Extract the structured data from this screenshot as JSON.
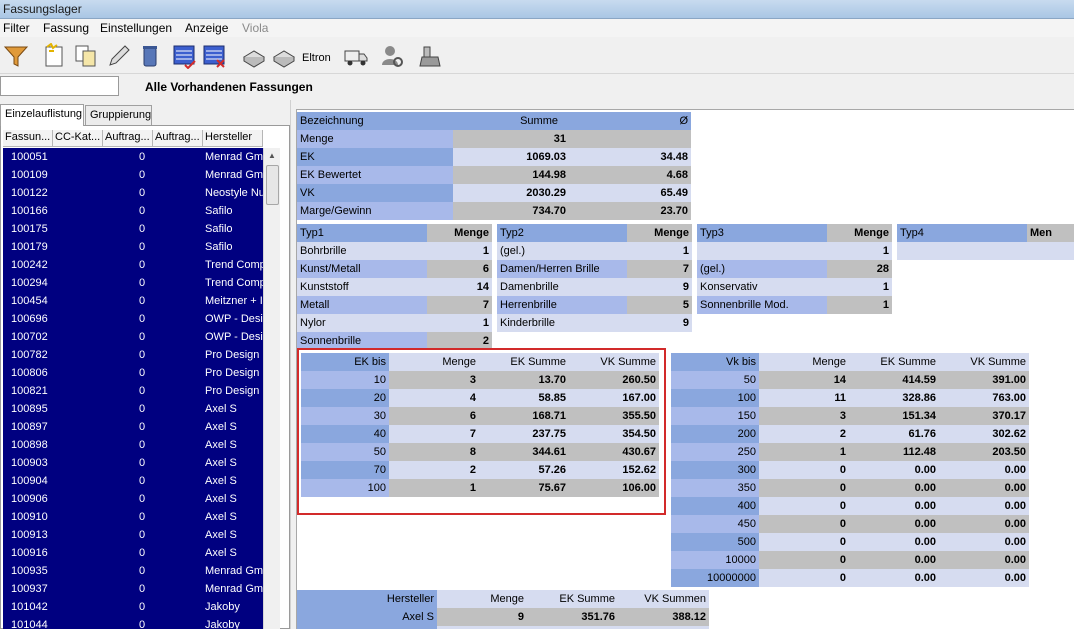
{
  "window": {
    "title": "Fassungslager"
  },
  "menu": [
    {
      "label": "Filter",
      "enabled": true
    },
    {
      "label": "Fassung",
      "enabled": true
    },
    {
      "label": "Einstellungen",
      "enabled": true
    },
    {
      "label": "Anzeige",
      "enabled": true
    },
    {
      "label": "Viola",
      "enabled": false
    }
  ],
  "toolbar": {
    "eltron_label": "Eltron"
  },
  "search": {
    "value": "",
    "placeholder": ""
  },
  "page_heading": "Alle Vorhandenen Fassungen",
  "tabs": [
    {
      "label": "Einzelauflistung",
      "active": true
    },
    {
      "label": "Gruppierung",
      "active": false
    }
  ],
  "grid": {
    "columns": [
      "Fassun...",
      "CC-Kat...",
      "Auftrag...",
      "Auftrag...",
      "Hersteller"
    ],
    "rows": [
      {
        "id": "100051",
        "cc": "0",
        "hersteller": "Menrad Gmb"
      },
      {
        "id": "100109",
        "cc": "0",
        "hersteller": "Menrad Gmb"
      },
      {
        "id": "100122",
        "cc": "0",
        "hersteller": "Neostyle Nu"
      },
      {
        "id": "100166",
        "cc": "0",
        "hersteller": "Safilo"
      },
      {
        "id": "100175",
        "cc": "0",
        "hersteller": "Safilo"
      },
      {
        "id": "100179",
        "cc": "0",
        "hersteller": "Safilo"
      },
      {
        "id": "100242",
        "cc": "0",
        "hersteller": "Trend Comp"
      },
      {
        "id": "100294",
        "cc": "0",
        "hersteller": "Trend Comp"
      },
      {
        "id": "100454",
        "cc": "0",
        "hersteller": "Meitzner + I"
      },
      {
        "id": "100696",
        "cc": "0",
        "hersteller": "OWP - Desig"
      },
      {
        "id": "100702",
        "cc": "0",
        "hersteller": "OWP - Desig"
      },
      {
        "id": "100782",
        "cc": "0",
        "hersteller": "Pro Design"
      },
      {
        "id": "100806",
        "cc": "0",
        "hersteller": "Pro Design"
      },
      {
        "id": "100821",
        "cc": "0",
        "hersteller": "Pro Design"
      },
      {
        "id": "100895",
        "cc": "0",
        "hersteller": "Axel S"
      },
      {
        "id": "100897",
        "cc": "0",
        "hersteller": "Axel S"
      },
      {
        "id": "100898",
        "cc": "0",
        "hersteller": "Axel S"
      },
      {
        "id": "100903",
        "cc": "0",
        "hersteller": "Axel S"
      },
      {
        "id": "100904",
        "cc": "0",
        "hersteller": "Axel S"
      },
      {
        "id": "100906",
        "cc": "0",
        "hersteller": "Axel S"
      },
      {
        "id": "100910",
        "cc": "0",
        "hersteller": "Axel S"
      },
      {
        "id": "100913",
        "cc": "0",
        "hersteller": "Axel S"
      },
      {
        "id": "100916",
        "cc": "0",
        "hersteller": "Axel S"
      },
      {
        "id": "100935",
        "cc": "0",
        "hersteller": "Menrad Gmb"
      },
      {
        "id": "100937",
        "cc": "0",
        "hersteller": "Menrad Gmb"
      },
      {
        "id": "101042",
        "cc": "0",
        "hersteller": "Jakoby"
      },
      {
        "id": "101044",
        "cc": "0",
        "hersteller": "Jakoby"
      }
    ]
  },
  "summary": {
    "headers": [
      "Bezeichnung",
      "Summe",
      "Ø"
    ],
    "rows": [
      {
        "label": "Menge",
        "sum": "31",
        "avg": ""
      },
      {
        "label": "EK",
        "sum": "1069.03",
        "avg": "34.48"
      },
      {
        "label": "EK Bewertet",
        "sum": "144.98",
        "avg": "4.68"
      },
      {
        "label": "VK",
        "sum": "2030.29",
        "avg": "65.49"
      },
      {
        "label": "Marge/Gewinn",
        "sum": "734.70",
        "avg": "23.70"
      }
    ]
  },
  "typ1": {
    "headers": [
      "Typ1",
      "Menge"
    ],
    "rows": [
      {
        "label": "Bohrbrille",
        "menge": "1"
      },
      {
        "label": "Kunst/Metall",
        "menge": "6"
      },
      {
        "label": "Kunststoff",
        "menge": "14"
      },
      {
        "label": "Metall",
        "menge": "7"
      },
      {
        "label": "Nylor",
        "menge": "1"
      },
      {
        "label": "Sonnenbrille",
        "menge": "2"
      }
    ]
  },
  "typ2": {
    "headers": [
      "Typ2",
      "Menge"
    ],
    "rows": [
      {
        "label": "(gel.)",
        "menge": "1"
      },
      {
        "label": "Damen/Herren Brille",
        "menge": "7"
      },
      {
        "label": "Damenbrille",
        "menge": "9"
      },
      {
        "label": "Herrenbrille",
        "menge": "5"
      },
      {
        "label": "Kinderbrille",
        "menge": "9"
      }
    ]
  },
  "typ3": {
    "headers": [
      "Typ3",
      "Menge"
    ],
    "rows": [
      {
        "label": "",
        "menge": "1"
      },
      {
        "label": "(gel.)",
        "menge": "28"
      },
      {
        "label": "Konservativ",
        "menge": "1"
      },
      {
        "label": "Sonnenbrille Mod.",
        "menge": "1"
      }
    ]
  },
  "typ4": {
    "headers": [
      "Typ4",
      "Men"
    ]
  },
  "ek_table": {
    "headers": [
      "EK bis",
      "Menge",
      "EK Summe",
      "VK Summe"
    ],
    "rows": [
      {
        "bis": "10",
        "menge": "3",
        "ek": "13.70",
        "vk": "260.50"
      },
      {
        "bis": "20",
        "menge": "4",
        "ek": "58.85",
        "vk": "167.00"
      },
      {
        "bis": "30",
        "menge": "6",
        "ek": "168.71",
        "vk": "355.50"
      },
      {
        "bis": "40",
        "menge": "7",
        "ek": "237.75",
        "vk": "354.50"
      },
      {
        "bis": "50",
        "menge": "8",
        "ek": "344.61",
        "vk": "430.67"
      },
      {
        "bis": "70",
        "menge": "2",
        "ek": "57.26",
        "vk": "152.62"
      },
      {
        "bis": "100",
        "menge": "1",
        "ek": "75.67",
        "vk": "106.00"
      }
    ]
  },
  "vk_table": {
    "headers": [
      "Vk bis",
      "Menge",
      "EK Summe",
      "VK Summe"
    ],
    "rows": [
      {
        "bis": "50",
        "menge": "14",
        "ek": "414.59",
        "vk": "391.00"
      },
      {
        "bis": "100",
        "menge": "11",
        "ek": "328.86",
        "vk": "763.00"
      },
      {
        "bis": "150",
        "menge": "3",
        "ek": "151.34",
        "vk": "370.17"
      },
      {
        "bis": "200",
        "menge": "2",
        "ek": "61.76",
        "vk": "302.62"
      },
      {
        "bis": "250",
        "menge": "1",
        "ek": "112.48",
        "vk": "203.50"
      },
      {
        "bis": "300",
        "menge": "0",
        "ek": "0.00",
        "vk": "0.00"
      },
      {
        "bis": "350",
        "menge": "0",
        "ek": "0.00",
        "vk": "0.00"
      },
      {
        "bis": "400",
        "menge": "0",
        "ek": "0.00",
        "vk": "0.00"
      },
      {
        "bis": "450",
        "menge": "0",
        "ek": "0.00",
        "vk": "0.00"
      },
      {
        "bis": "500",
        "menge": "0",
        "ek": "0.00",
        "vk": "0.00"
      },
      {
        "bis": "10000",
        "menge": "0",
        "ek": "0.00",
        "vk": "0.00"
      },
      {
        "bis": "10000000",
        "menge": "0",
        "ek": "0.00",
        "vk": "0.00"
      }
    ]
  },
  "hersteller_table": {
    "headers": [
      "Hersteller",
      "Menge",
      "EK Summe",
      "VK Summen"
    ],
    "rows": [
      {
        "name": "Axel S",
        "menge": "9",
        "ek": "351.76",
        "vk": "388.12"
      }
    ]
  },
  "colors": {
    "grid_bg": "#000080",
    "header_blue": "#8aa7de",
    "highlight": "#d22a2a"
  }
}
